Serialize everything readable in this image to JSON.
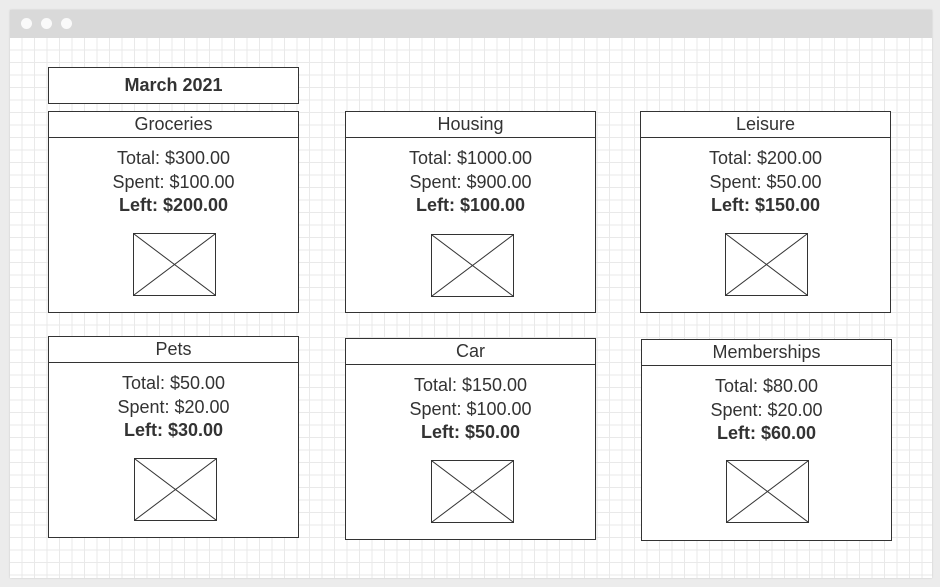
{
  "window": {
    "dots": [
      "close",
      "minimize",
      "maximize"
    ]
  },
  "month_label": "March 2021",
  "cards": [
    {
      "title": "Groceries",
      "total": "Total: $300.00",
      "spent": "Spent: $100.00",
      "left": "Left: $200.00",
      "image_icon": "image-placeholder-icon"
    },
    {
      "title": "Housing",
      "total": "Total: $1000.00",
      "spent": "Spent: $900.00",
      "left": "Left: $100.00",
      "image_icon": "image-placeholder-icon"
    },
    {
      "title": "Leisure",
      "total": "Total: $200.00",
      "spent": "Spent: $50.00",
      "left": "Left: $150.00",
      "image_icon": "image-placeholder-icon"
    },
    {
      "title": "Pets",
      "total": "Total: $50.00",
      "spent": "Spent: $20.00",
      "left": "Left: $30.00",
      "image_icon": "image-placeholder-icon"
    },
    {
      "title": "Car",
      "total": "Total: $150.00",
      "spent": "Spent: $100.00",
      "left": "Left: $50.00",
      "image_icon": "image-placeholder-icon"
    },
    {
      "title": "Memberships",
      "total": "Total: $80.00",
      "spent": "Spent: $20.00",
      "left": "Left: $60.00",
      "image_icon": "image-placeholder-icon"
    }
  ]
}
